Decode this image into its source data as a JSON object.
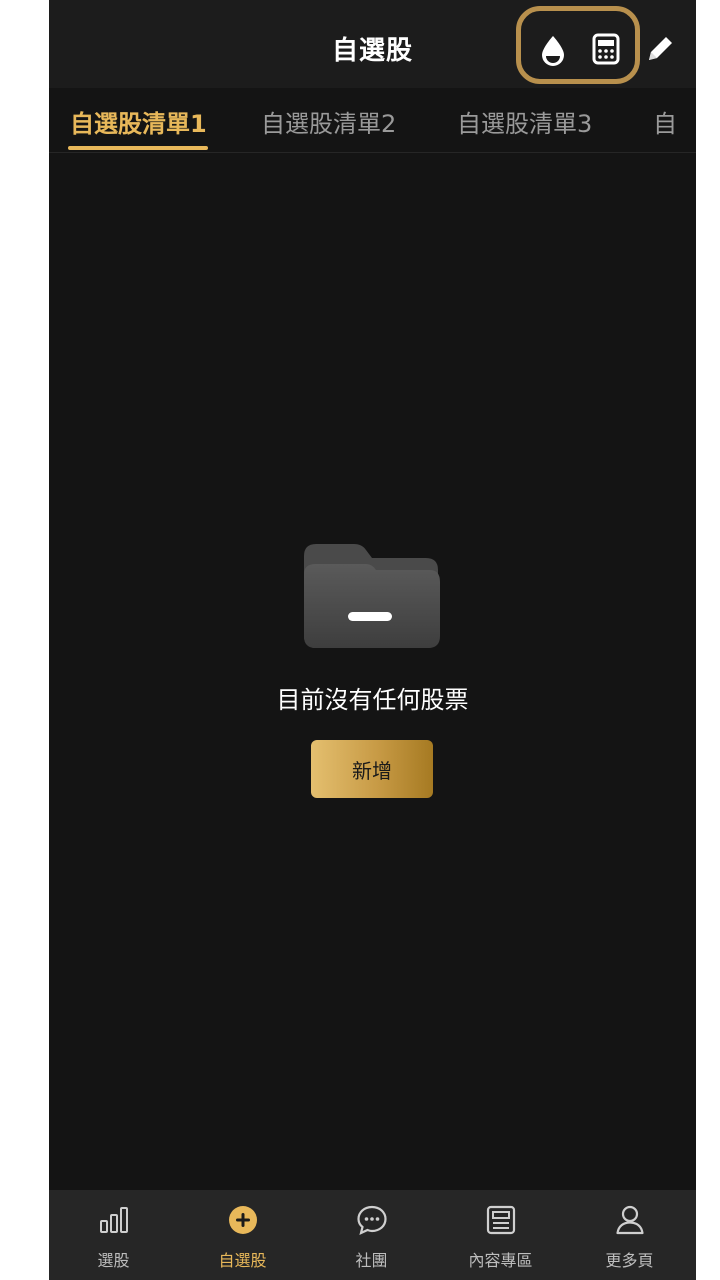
{
  "header": {
    "title": "自選股",
    "icons": [
      "water-drop-icon",
      "calculator-icon",
      "pencil-edit-icon"
    ]
  },
  "tabs": [
    {
      "label": "自選股清單1",
      "active": true
    },
    {
      "label": "自選股清單2",
      "active": false
    },
    {
      "label": "自選股清單3",
      "active": false
    },
    {
      "label": "自",
      "active": false
    }
  ],
  "empty_state": {
    "icon": "folder-minus-icon",
    "message": "目前沒有任何股票",
    "add_label": "新增"
  },
  "bottom_nav": [
    {
      "label": "選股",
      "icon": "bar-chart-icon",
      "active": false
    },
    {
      "label": "自選股",
      "icon": "plus-circle-icon",
      "active": true
    },
    {
      "label": "社團",
      "icon": "chat-bubble-icon",
      "active": false
    },
    {
      "label": "內容專區",
      "icon": "news-icon",
      "active": false
    },
    {
      "label": "更多頁",
      "icon": "person-icon",
      "active": false
    }
  ],
  "colors": {
    "accent": "#e8b85a",
    "background": "#141414",
    "header_bg": "#1c1c1c",
    "nav_bg": "#262626",
    "highlight_ring": "#b8904d"
  }
}
